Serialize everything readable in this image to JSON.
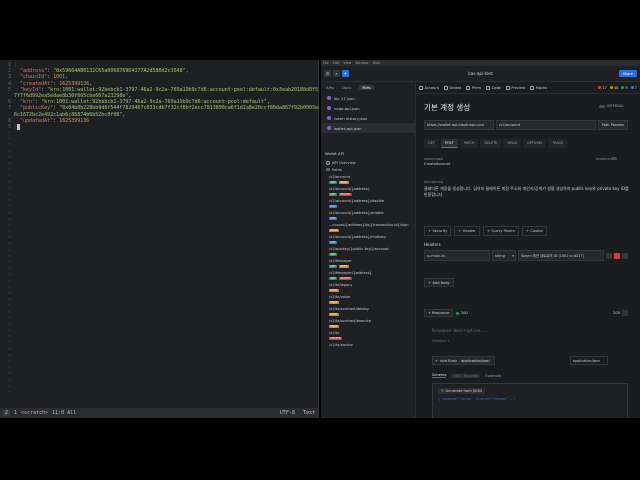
{
  "vim": {
    "lines": [
      {
        "num": "1",
        "html": "<span class=\"tilde\">{</span>"
      },
      {
        "num": "2",
        "html": "  <span class=\"k\">\"address\"</span>: <span class=\"s\">\"0x59664AB0132C65a0068769D4377A2d580d2c3648\"</span>,"
      },
      {
        "num": "3",
        "html": "  <span class=\"k\">\"chainId\"</span>: <span class=\"n\">1001</span>,"
      },
      {
        "num": "4",
        "html": "  <span class=\"k\">\"createdAt\"</span>: <span class=\"n\">1625399136</span>,"
      },
      {
        "num": "5",
        "html": "  <span class=\"k\">\"keyId\"</span>: <span class=\"s\">\"krn:1001:wallet:92bebcb1-3797-46a2-9c2a-769a19b9c7d6:account-pool:default:0x3eab20188d8f5a4a9ae2e775e</span>"
      },
      {
        "num": "",
        "html": "<span class=\"s\">7f7f6d992ea5edae8b30f065cbe667a23298e\"</span>,"
      },
      {
        "num": "6",
        "html": "  <span class=\"k\">\"krn\"</span>: <span class=\"s\">\"krn:1001:wallet:92bebcb1-3797-46a2-9c2a-769a19b9c7d6:account-pool:default\"</span>,"
      },
      {
        "num": "7",
        "html": "  <span class=\"k\">\"publicKey\"</span>: <span class=\"s\">\"0x04b0b228bb0d6f544f7829467c033cdb7f32cf8bf2ecc7813890ca6f1d2a8e20ccf80da867f92b0003a42c02436650ee7ab</span>"
      },
      {
        "num": "",
        "html": "<span class=\"s\">6c1672bc2e492c1ab6c86874b6b52bc0f08\"</span>,"
      },
      {
        "num": "8",
        "html": "  <span class=\"k\">\"updatedAt\"</span>: <span class=\"n\">1625399136</span>"
      },
      {
        "num": "9",
        "html": "<span class=\"tilde\">}</span><span class=\"cursor\"></span>"
      }
    ],
    "tilde_count": 43,
    "status": {
      "mode": "2",
      "number": "1",
      "buffer": "<scratch>",
      "position": "11:0 All",
      "encoding": "UTF-8",
      "filetype": "Text"
    }
  },
  "app": {
    "menu": [
      "File",
      "Edit",
      "View",
      "Window",
      "Help"
    ],
    "title": "kas-api-test",
    "share_label": "Share",
    "sidebar_tabs": [
      "APIs",
      "Docs",
      "Files"
    ],
    "files": [
      {
        "label": "kip 17 json"
      },
      {
        "label": "node-api.json"
      },
      {
        "label": "token history.json"
      },
      {
        "label": "wallet-api.json"
      }
    ],
    "wallet_title": "Wallet API",
    "tree": {
      "overview": "API Overview",
      "paths": "Paths",
      "items": [
        {
          "label": "/v2/account",
          "methods": [
            "GET",
            "POST"
          ]
        },
        {
          "label": "/v2/account/{address}",
          "methods": [
            "GET",
            "DELETE"
          ]
        },
        {
          "label": "/v2/account/{address}/disable",
          "methods": [
            "PUT"
          ]
        },
        {
          "label": "/v2/account/{address}/enable",
          "methods": [
            "PUT"
          ]
        },
        {
          "label": "...ccount/{address}/tx/{transaction-id}/sign",
          "methods": [
            "POST"
          ]
        },
        {
          "label": "/v2/account/{address}/multisig",
          "methods": [
            "PUT"
          ]
        },
        {
          "label": "/v2/pubkey/{public-key}/account",
          "methods": [
            "GET"
          ]
        },
        {
          "label": "/v2/feepayer",
          "methods": [
            "GET",
            "POST"
          ]
        },
        {
          "label": "/v2/feepayer/{address}",
          "methods": [
            "GET",
            "DELETE"
          ]
        },
        {
          "label": "/v2/tx/legacy",
          "methods": [
            "POST"
          ]
        },
        {
          "label": "/v2/tx/value",
          "methods": [
            "POST"
          ]
        },
        {
          "label": "/v2/tx/contract/deploy",
          "methods": [
            "POST"
          ]
        },
        {
          "label": "/v2/tx/contract/execute",
          "methods": [
            "POST"
          ]
        },
        {
          "label": "/v2/tx",
          "methods": [
            "DELETE"
          ]
        },
        {
          "label": "/v2/tx/anchor",
          "methods": []
        }
      ]
    },
    "toolbar": {
      "items": [
        "Account",
        "Delete",
        "Perm",
        "Code",
        "Preview",
        "Mocks"
      ],
      "counts": [
        "17",
        "48",
        "9",
        "7"
      ]
    },
    "page_title": "기본 계정 생성",
    "internal_label": "INTERNAL",
    "base_url": "https://wallet-api.klaytnapi.com",
    "path": "/v2/account",
    "path_params": "Path Params",
    "method_tabs": [
      "GET",
      "POST",
      "PATCH",
      "DELETE",
      "HEAD",
      "OPTIONS",
      "TRACE"
    ],
    "active_method": "POST",
    "operation_id_label": "OPERATIONID",
    "operation_id": "CreateAccount",
    "deprecated_label": "DEPRECATED",
    "description_label": "DESCRIPTION",
    "description": "클레이튼 계정을 생성합니다. 임의의 클레이튼 계정 주소와 개인키/공개키 쌍을 생성하여 public key와 private key ID를 반환합니다.",
    "param_tabs": [
      "Security",
      "Header",
      "Query Param",
      "Cookie"
    ],
    "headers_label": "Headers",
    "header": {
      "name": "x-chain-id",
      "type": "string",
      "description": "Klaytn 체인 네트워크 ID (1001 or 8217)"
    },
    "add_body": "Add Body",
    "response": {
      "label": "Response",
      "status": "200",
      "code": "200",
      "description_placeholder": "Response description...",
      "headers_placeholder": "Headers",
      "add_body": "Add Body",
      "content_type": "application/json",
      "content_type_input": "application/json",
      "tabs": [
        "Schema",
        "200 - Success",
        "Example"
      ],
      "generate": "Generate from JSON",
      "schema_line": "{ \"address\": \"string\", \"chainId\": \"integer\" ... }"
    }
  }
}
